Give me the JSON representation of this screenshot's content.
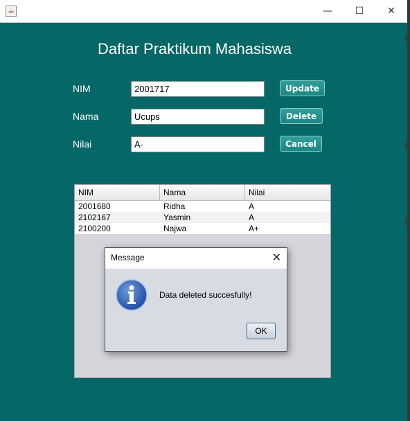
{
  "window": {
    "controls": {
      "minimize": "—",
      "maximize": "☐",
      "close": "✕"
    }
  },
  "heading": "Daftar Praktikum Mahasiswa",
  "form": {
    "nim_label": "NIM",
    "nim_value": "2001717",
    "nama_label": "Nama",
    "nama_value": "Ucups",
    "nilai_label": "Nilai",
    "nilai_value": "A-",
    "update_label": "Update",
    "delete_label": "Delete",
    "cancel_label": "Cancel"
  },
  "table": {
    "columns": [
      "NIM",
      "Nama",
      "Nilai"
    ],
    "rows": [
      [
        "2001680",
        "Ridha",
        "A"
      ],
      [
        "2102167",
        "Yasmin",
        "A"
      ],
      [
        "2100200",
        "Najwa",
        "A+"
      ]
    ]
  },
  "dialog": {
    "title": "Message",
    "message": "Data deleted succesfully!",
    "ok_label": "OK",
    "icon": "info-icon"
  },
  "colors": {
    "background": "#056766",
    "button": "#1d8682",
    "info_icon": "#2a5fb0"
  }
}
